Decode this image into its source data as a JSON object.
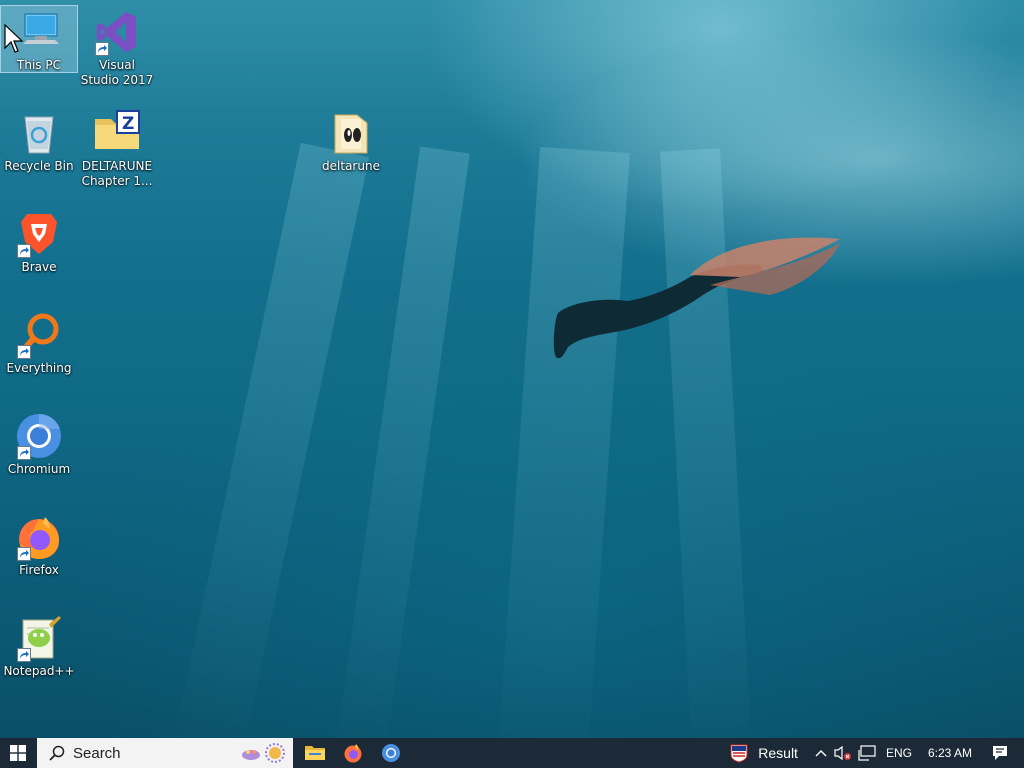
{
  "desktop": {
    "icons": [
      {
        "label": "This PC",
        "icon": "this-pc-icon"
      },
      {
        "label": "Visual Studio 2017",
        "icon": "visual-studio-icon"
      },
      {
        "label": "Recycle Bin",
        "icon": "recycle-bin-icon"
      },
      {
        "label": "DELTARUNE Chapter 1...",
        "icon": "zip-folder-icon"
      },
      {
        "label": "deltarune",
        "icon": "folder-icon"
      },
      {
        "label": "Brave",
        "icon": "brave-icon"
      },
      {
        "label": "Everything",
        "icon": "everything-icon"
      },
      {
        "label": "Chromium",
        "icon": "chromium-icon"
      },
      {
        "label": "Firefox",
        "icon": "firefox-icon"
      },
      {
        "label": "Notepad++",
        "icon": "notepad-plus-plus-icon"
      }
    ]
  },
  "taskbar": {
    "start": {
      "icon": "windows-start-icon"
    },
    "search": {
      "placeholder": "Search",
      "icon": "search-icon"
    },
    "pinned": [
      {
        "name": "File Explorer",
        "icon": "file-explorer-icon"
      },
      {
        "name": "Firefox",
        "icon": "firefox-icon"
      },
      {
        "name": "Chromium",
        "icon": "chromium-icon"
      }
    ],
    "tray": {
      "widget_label": "Result",
      "language": "ENG",
      "time": "6:23 AM"
    }
  },
  "colors": {
    "taskbar_bg": "#1b2a36",
    "search_bg": "#f3f3f3",
    "water_dark": "#0a4f68",
    "water_light": "#2f8ea8"
  }
}
